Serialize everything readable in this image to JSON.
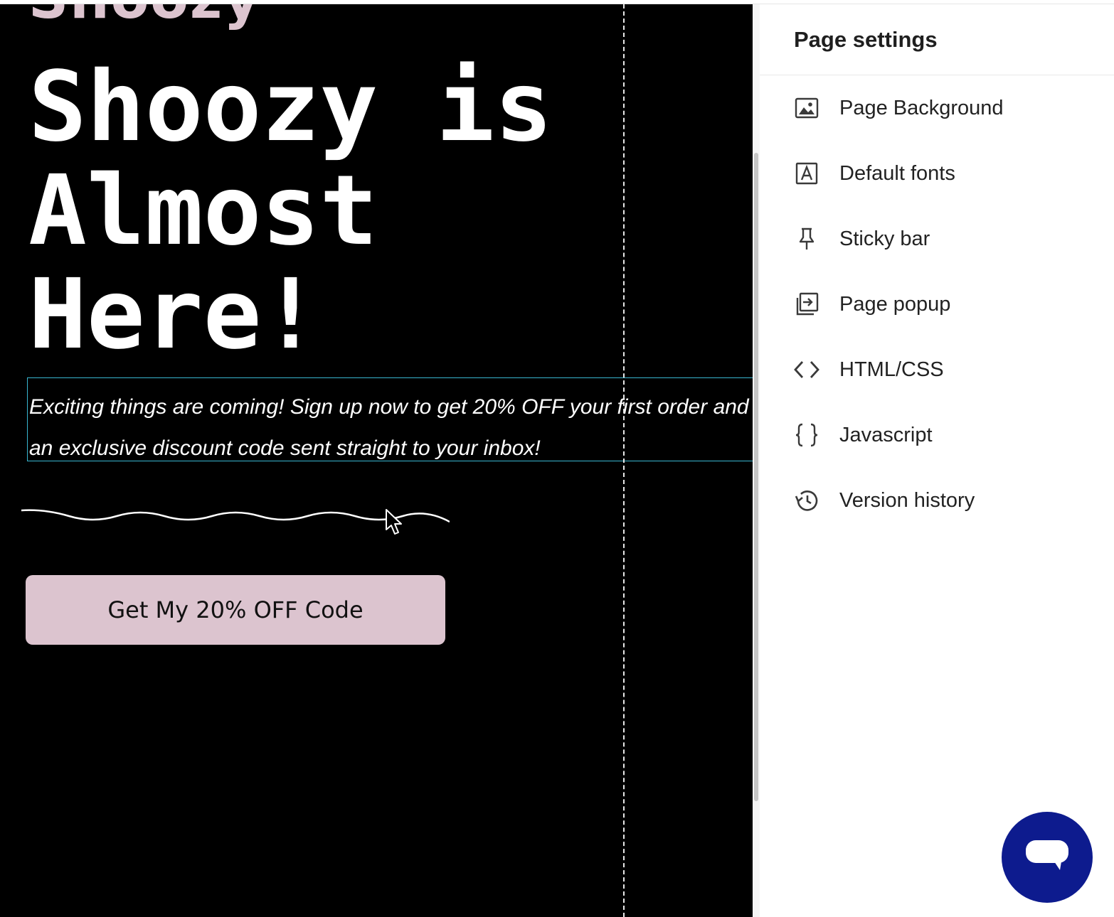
{
  "canvas": {
    "logo_text": "Shoozy",
    "headline": "Shoozy is Almost Here!",
    "subtext": "Exciting things are coming! Sign up now to get 20% OFF your first order and an exclusive discount code sent straight to your inbox!",
    "cta_label": "Get My 20% OFF Code"
  },
  "panel": {
    "title": "Page settings",
    "items": [
      {
        "label": "Page Background",
        "icon": "image-icon"
      },
      {
        "label": "Default fonts",
        "icon": "font-icon"
      },
      {
        "label": "Sticky bar",
        "icon": "pin-icon"
      },
      {
        "label": "Page popup",
        "icon": "popup-icon"
      },
      {
        "label": "HTML/CSS",
        "icon": "code-icon"
      },
      {
        "label": "Javascript",
        "icon": "braces-icon"
      },
      {
        "label": "Version history",
        "icon": "history-icon"
      }
    ]
  },
  "colors": {
    "canvas_bg": "#000000",
    "accent_pink": "#dcc4cf",
    "selection_blue": "#38b6d0",
    "chat_fab": "#0d1b8e"
  }
}
